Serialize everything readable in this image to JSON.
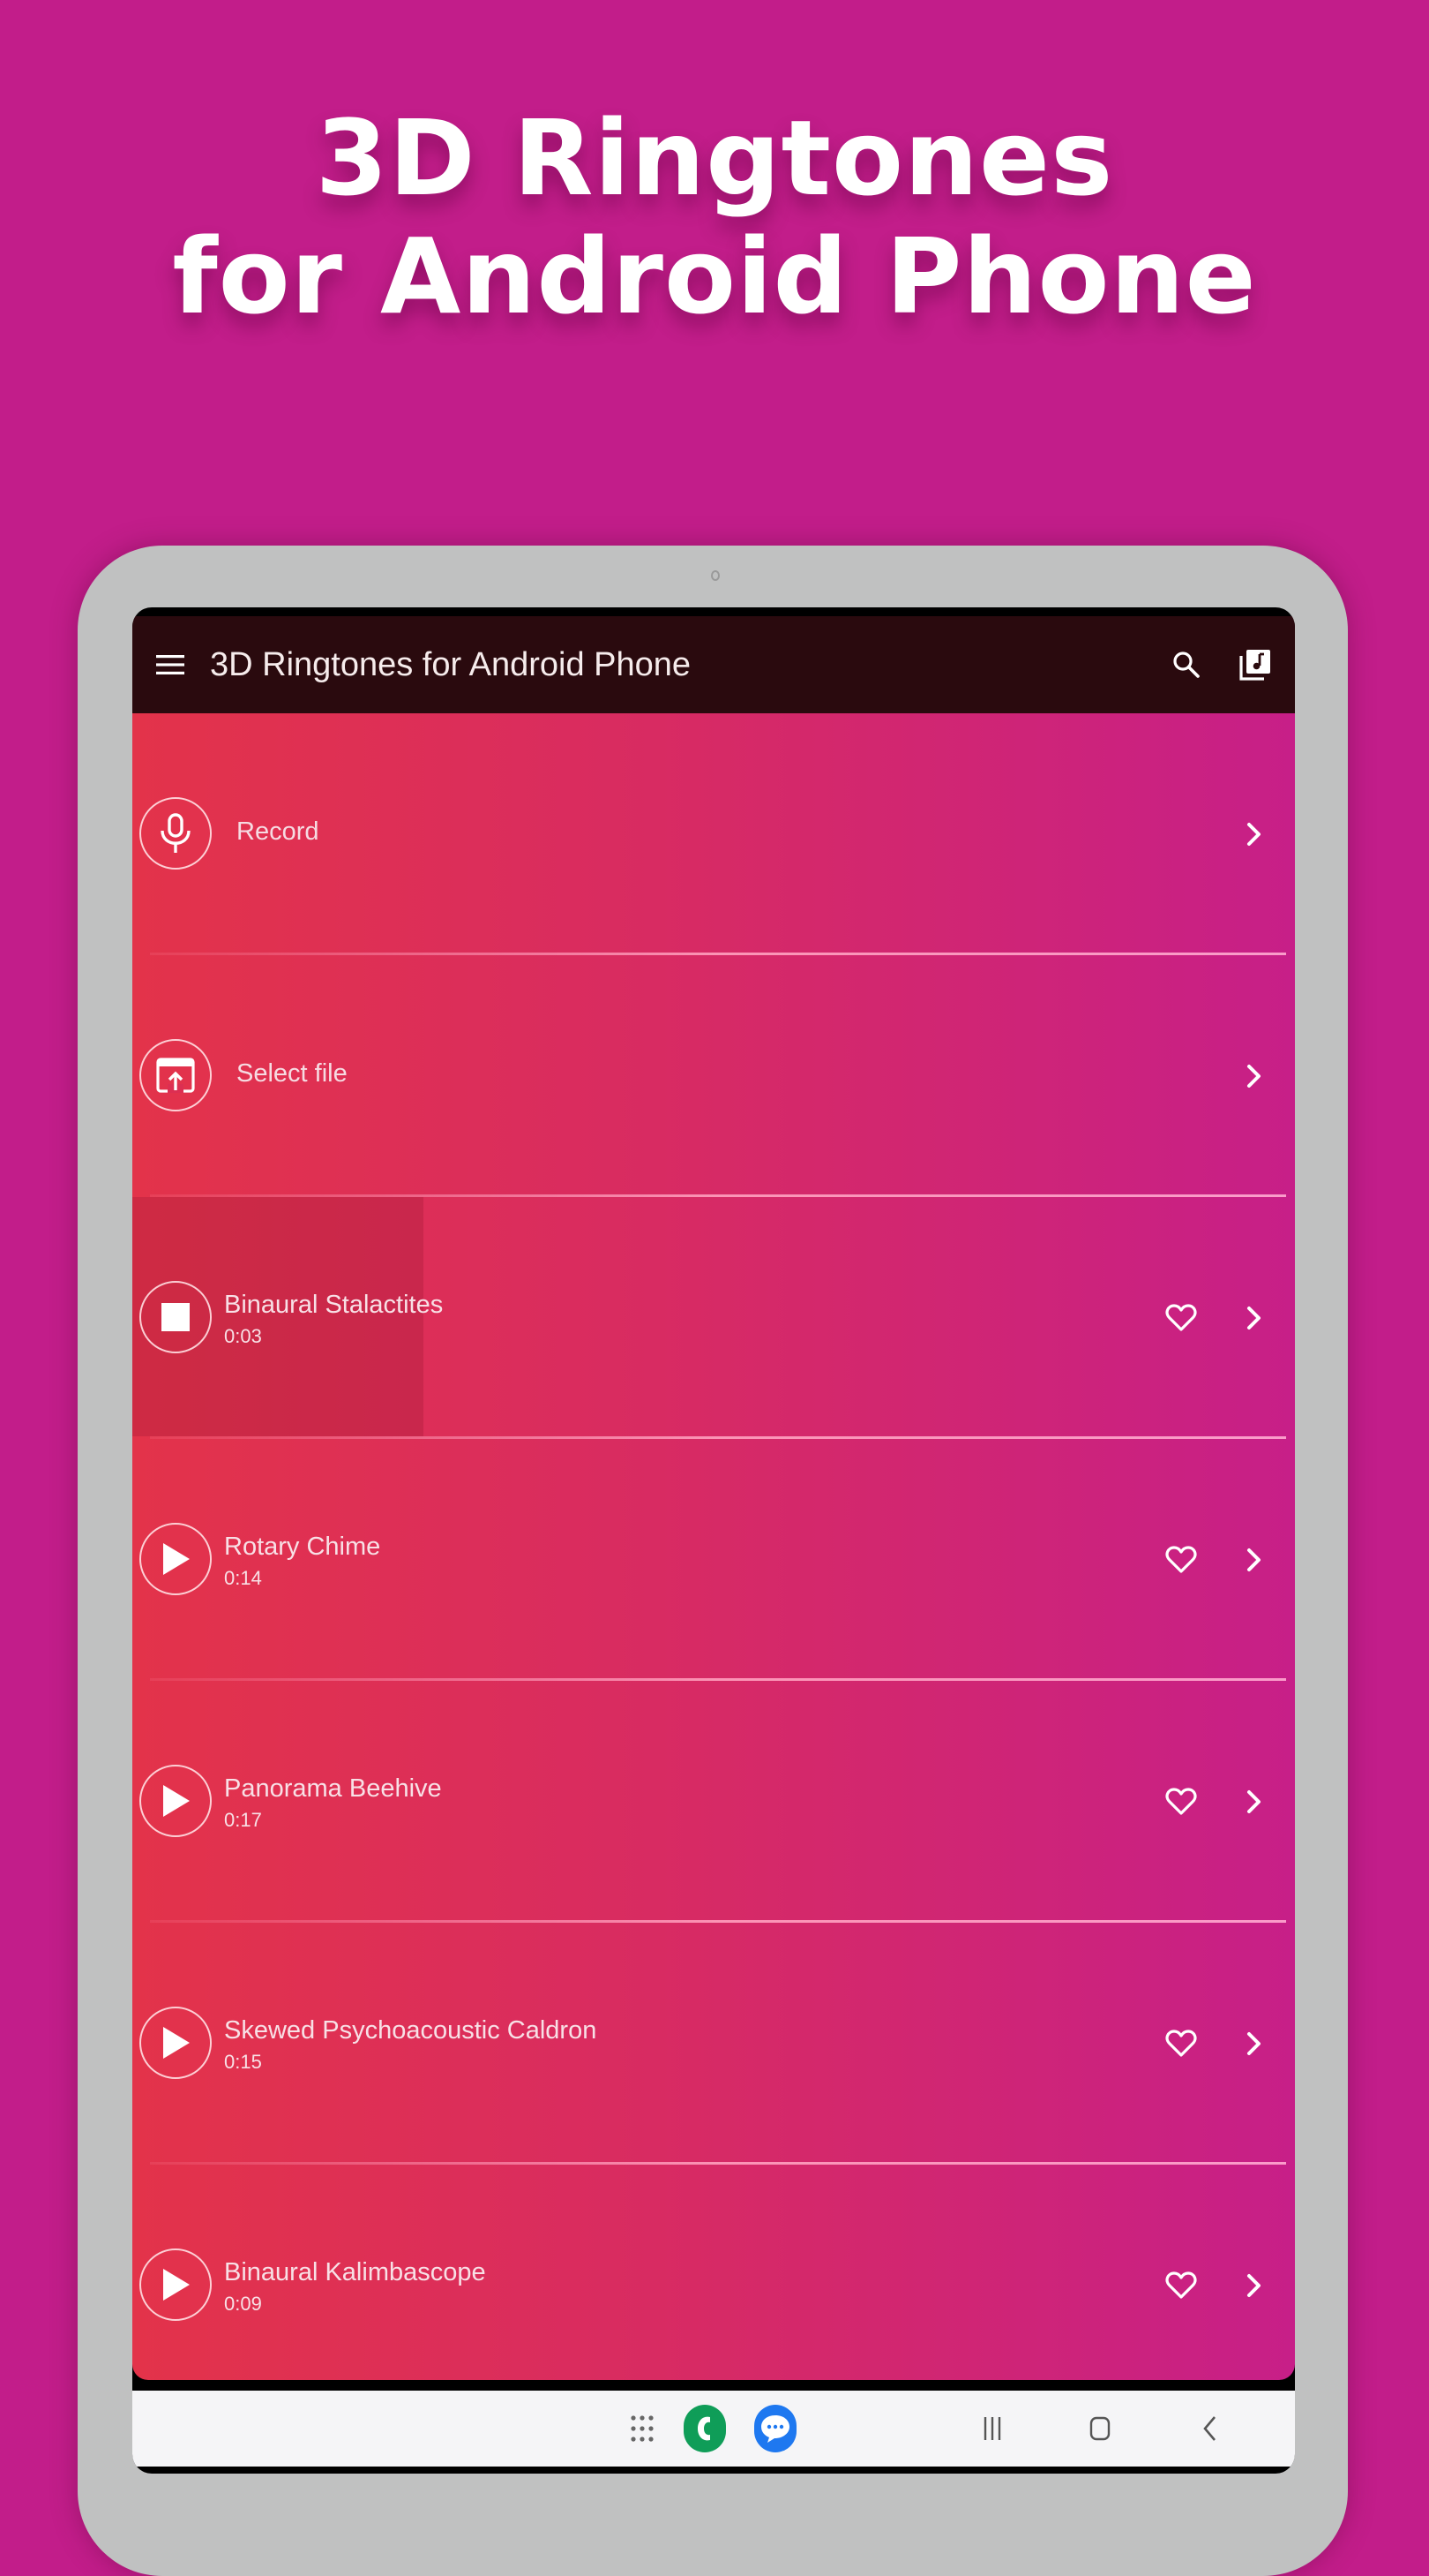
{
  "headline": {
    "line1": "3D Ringtones",
    "line2": "for Android Phone"
  },
  "toolbar": {
    "title": "3D Ringtones for Android Phone",
    "menu_icon": "hamburger-menu-icon",
    "search_icon": "search-icon",
    "library_icon": "music-library-icon"
  },
  "actions": [
    {
      "label": "Record",
      "icon": "microphone-icon"
    },
    {
      "label": "Select file",
      "icon": "file-upload-icon"
    }
  ],
  "songs": [
    {
      "title": "Binaural Stalactites",
      "duration": "0:03",
      "state": "playing",
      "progress_percent": 25
    },
    {
      "title": "Rotary Chime",
      "duration": "0:14",
      "state": "stopped"
    },
    {
      "title": "Panorama Beehive",
      "duration": "0:17",
      "state": "stopped"
    },
    {
      "title": "Skewed Psychoacoustic Caldron",
      "duration": "0:15",
      "state": "stopped"
    },
    {
      "title": "Binaural Kalimbascope",
      "duration": "0:09",
      "state": "stopped"
    }
  ],
  "navbar": {
    "items": [
      "app-drawer-icon",
      "phone-app-icon",
      "messages-app-icon",
      "recents-icon",
      "home-icon",
      "back-icon"
    ]
  },
  "colors": {
    "background": "#c21d8a",
    "toolbar": "#2a0a0e",
    "gradient_start": "#e3334a",
    "gradient_end": "#c71f88",
    "phone_app": "#0f9d58",
    "messages_app": "#1e78f0"
  }
}
